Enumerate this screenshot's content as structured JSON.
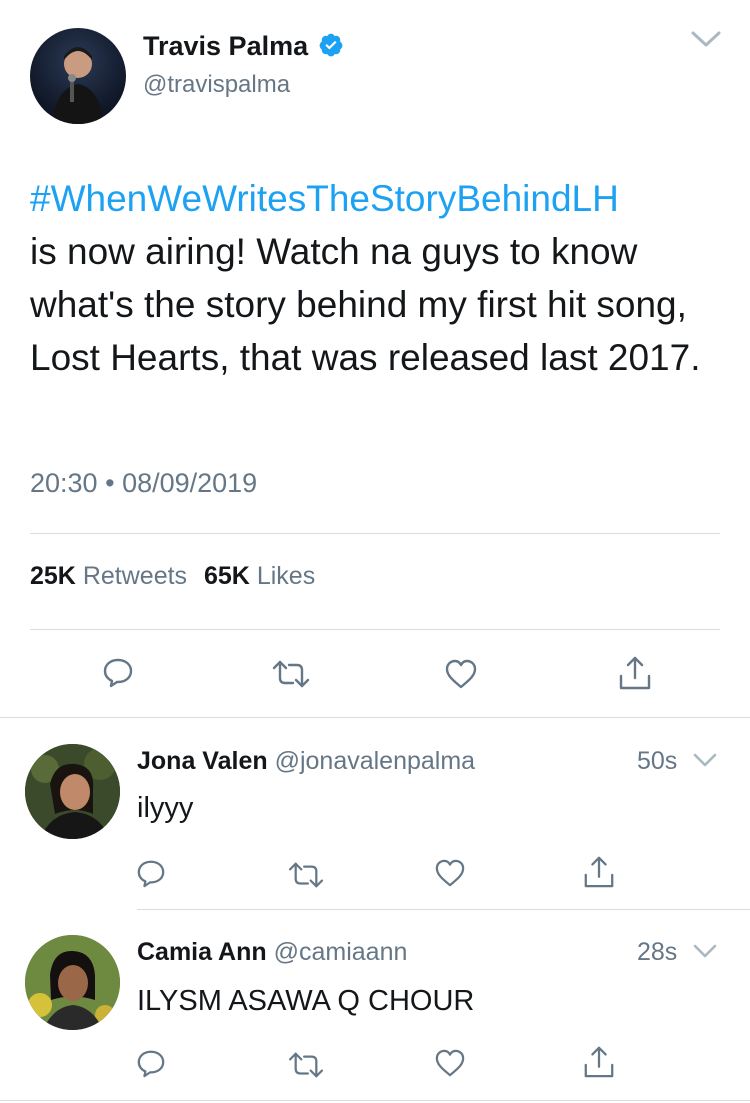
{
  "tweet": {
    "author": {
      "name": "Travis Palma",
      "handle": "@travispalma",
      "verified": true
    },
    "hashtag": "#WhenWeWritesTheStoryBehindLH",
    "body": "is now airing! Watch na guys to know what's the story behind my first hit song, Lost Hearts, that was released last 2017.",
    "time": "20:30",
    "separator": "•",
    "date": "08/09/2019",
    "stats": {
      "retweets_count": "25K",
      "retweets_label": "Retweets",
      "likes_count": "65K",
      "likes_label": "Likes"
    },
    "actions": [
      "reply-icon",
      "retweet-icon",
      "like-icon",
      "share-icon"
    ]
  },
  "replies": [
    {
      "name": "Jona Valen",
      "handle": "@jonavalenpalma",
      "time": "50s",
      "text": "ilyyy"
    },
    {
      "name": "Camia Ann",
      "handle": "@camiaann",
      "time": "28s",
      "text": "ILYSM ASAWA Q CHOUR"
    }
  ],
  "colors": {
    "link": "#1da1f2",
    "text": "#14171a",
    "muted": "#657786",
    "verified": "#1da1f2"
  }
}
